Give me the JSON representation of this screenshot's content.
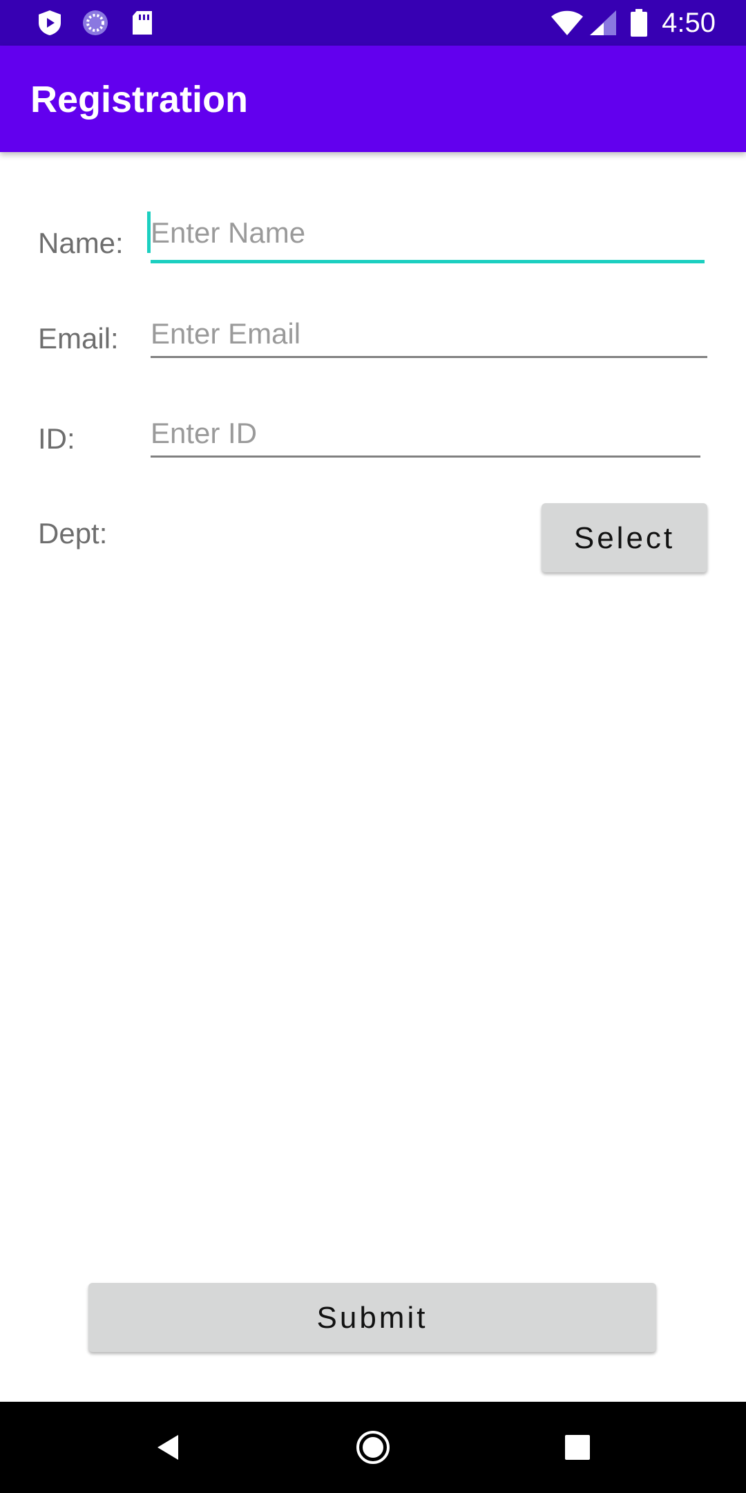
{
  "status_bar": {
    "time": "4:50",
    "left_icons": [
      "shield-play-icon",
      "loading-circle-icon",
      "sd-card-icon"
    ],
    "right_icons": [
      "wifi-icon",
      "cell-signal-icon",
      "battery-icon"
    ]
  },
  "app_bar": {
    "title": "Registration",
    "color": "#6200ee"
  },
  "form": {
    "name": {
      "label": "Name:",
      "placeholder": "Enter Name",
      "value": ""
    },
    "email": {
      "label": "Email:",
      "placeholder": "Enter Email",
      "value": ""
    },
    "id": {
      "label": "ID:",
      "placeholder": "Enter ID",
      "value": ""
    },
    "dept": {
      "label": "Dept:",
      "button_label": "Select"
    }
  },
  "submit_label": "Submit",
  "accent_color": "#1ccfc0",
  "nav_bar": {
    "icons": [
      "back-icon",
      "home-icon",
      "recents-icon"
    ]
  }
}
